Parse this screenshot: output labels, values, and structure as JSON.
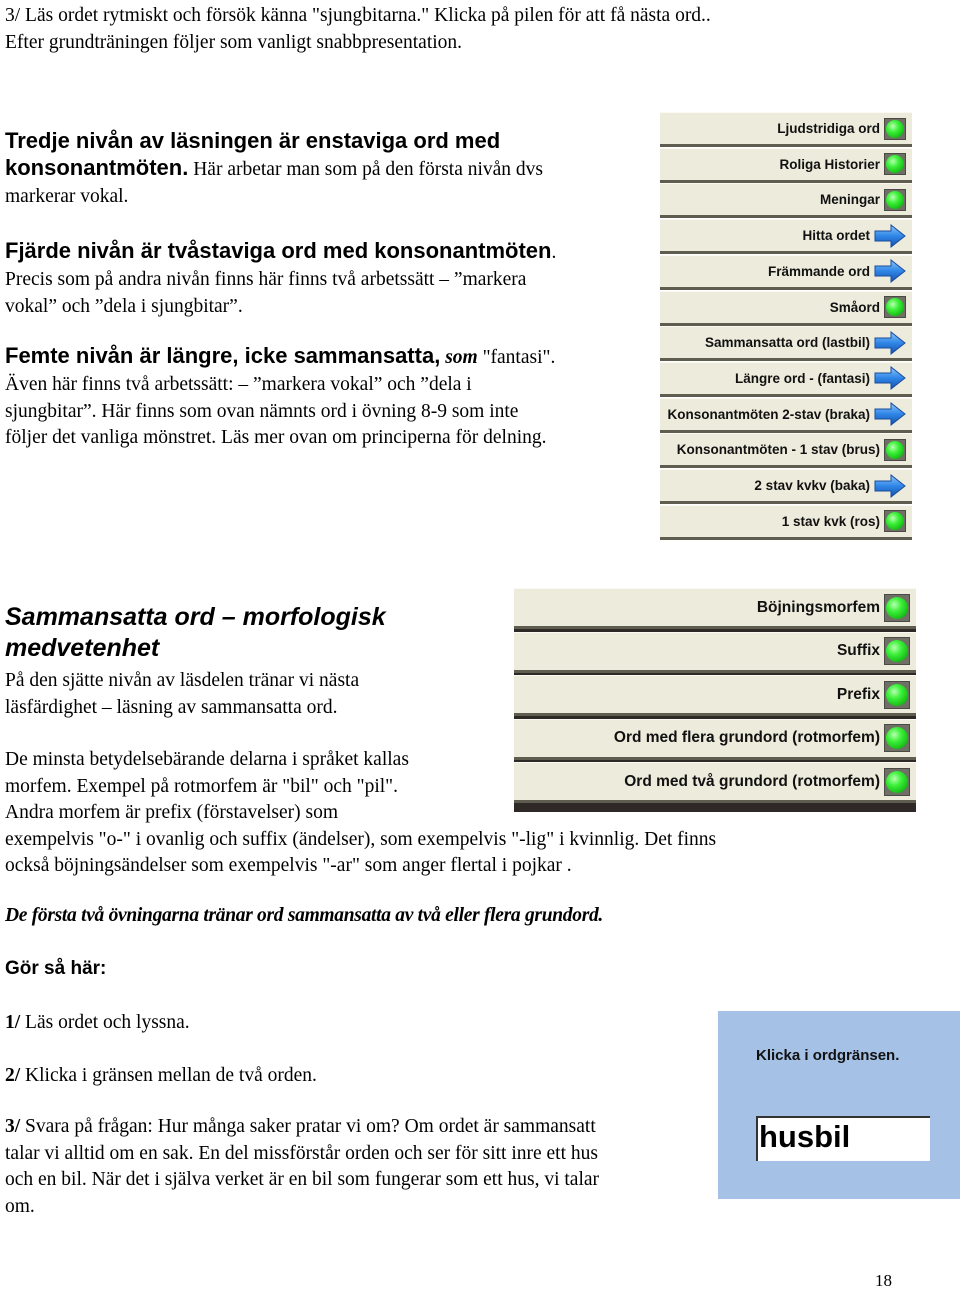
{
  "intro": {
    "line1": "3/ Läs ordet rytmiskt och försök känna \"sjungbitarna.\" Klicka på pilen för att få nästa ord..",
    "line2": "Efter grundträningen följer som vanligt snabbpresentation."
  },
  "level3": {
    "heading_line1": "Tredje nivån av läsningen är enstaviga ord med",
    "heading_line2_bold": "konsonantmöten.",
    "heading_line2_text": " Här arbetar man som på den första nivån dvs",
    "line3": "markerar vokal."
  },
  "level4": {
    "heading": "Fjärde nivån är tvåstaviga ord med konsonantmöten",
    "heading_dot": ".",
    "line1": "Precis som på andra nivån finns här finns två arbetssätt  – ”markera",
    "line2": "vokal” och ”dela i sjungbitar”."
  },
  "level5": {
    "heading": "Femte nivån är längre, icke sammansatta,",
    "som": "som",
    "example": " \"fantasi\".",
    "line1": "Även här finns två arbetssätt: – ”markera vokal” och ”dela i",
    "line2": "sjungbitar”. Här finns som ovan nämnts ord i övning 8-9 som inte",
    "line3": "följer det vanliga mönstret. Läs mer ovan om principerna för delning."
  },
  "menu_panel": {
    "items": [
      {
        "label": "Ljudstridiga ord",
        "icon": "green-led-icon"
      },
      {
        "label": "Roliga Historier",
        "icon": "green-led-icon"
      },
      {
        "label": "Meningar",
        "icon": "green-led-icon"
      },
      {
        "label": "Hitta ordet",
        "icon": "blue-arrow-icon"
      },
      {
        "label": "Främmande ord",
        "icon": "blue-arrow-icon"
      },
      {
        "label": "Småord",
        "icon": "green-led-icon"
      },
      {
        "label": "Sammansatta ord (lastbil)",
        "icon": "blue-arrow-icon"
      },
      {
        "label": "Längre ord - (fantasi)",
        "icon": "blue-arrow-icon"
      },
      {
        "label": "Konsonantmöten 2-stav (braka)",
        "icon": "blue-arrow-icon"
      },
      {
        "label": "Konsonantmöten - 1 stav (brus)",
        "icon": "green-led-icon"
      },
      {
        "label": "2 stav kvkv (baka)",
        "icon": "blue-arrow-icon"
      },
      {
        "label": "1 stav kvk (ros)",
        "icon": "green-led-icon"
      }
    ]
  },
  "compound": {
    "heading_line1": "Sammansatta ord – morfologisk",
    "heading_line2": "medvetenhet",
    "p1_line1": "På den sjätte nivån av läsdelen tränar vi nästa",
    "p1_line2": "läsfärdighet – läsning av sammansatta ord.",
    "p2_line1": "De minsta betydelsebärande delarna i språket kallas",
    "p2_line2": "morfem. Exempel på rotmorfem är \"bil\" och \"pil\".",
    "p2_line3": "Andra morfem är prefix (förstavelser) som",
    "p2_line4": "exempelvis \"o-\" i ovanlig och suffix (ändelser), som exempelvis \"-lig\" i kvinnlig. Det finns",
    "p2_line5": "också böjningsändelser som exempelvis \"-ar\" som anger flertal i pojkar ."
  },
  "morph_panel": {
    "items": [
      {
        "label": "Böjningsmorfem",
        "icon": "green-led-icon"
      },
      {
        "label": "Suffix",
        "icon": "green-led-icon"
      },
      {
        "label": "Prefix",
        "icon": "green-led-icon"
      },
      {
        "label": "Ord med flera grundord (rotmorfem)",
        "icon": "green-led-icon"
      },
      {
        "label": "Ord med två grundord (rotmorfem)",
        "icon": "green-led-icon"
      }
    ]
  },
  "exercise_note": "De  första två  övningarna tränar ord sammansatta av två eller flera grundord.",
  "howto": {
    "heading": "Gör så här:",
    "steps": [
      {
        "num": "1/",
        "text": " Läs ordet och lyssna."
      },
      {
        "num": "2/",
        "text": " Klicka i gränsen mellan de två orden."
      },
      {
        "num": "3/",
        "text": " Svara på frågan: Hur många saker pratar vi om? Om ordet är sammansatt"
      }
    ],
    "step3_line2": "talar vi alltid om en sak. En del missförstår orden och ser för sitt inre ett hus",
    "step3_line3": "och en bil. När det i själva verket är en bil som fungerar som ett hus, vi talar",
    "step3_line4": "om."
  },
  "ord_widget": {
    "title": "Klicka i ordgränsen.",
    "word": "husbil"
  },
  "page_number": "18"
}
